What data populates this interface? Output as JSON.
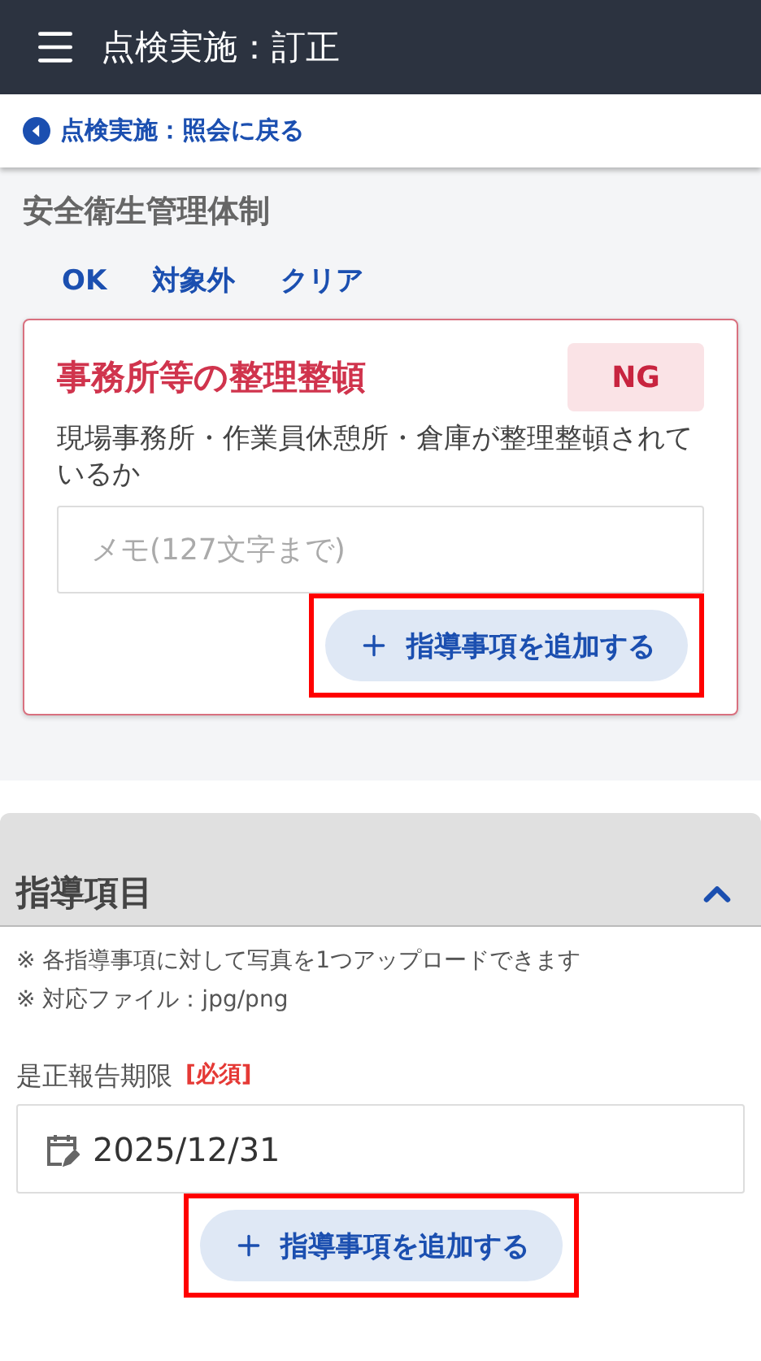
{
  "header": {
    "title": "点検実施：訂正"
  },
  "back_link": {
    "label": "点検実施：照会に戻る"
  },
  "section": {
    "title": "安全衛生管理体制",
    "choices": [
      {
        "label": "OK"
      },
      {
        "label": "対象外"
      },
      {
        "label": "クリア"
      }
    ],
    "item": {
      "title": "事務所等の整理整頓",
      "status": "NG",
      "description": "現場事務所・作業員休憩所・倉庫が整理整頓されているか",
      "memo": {
        "placeholder": "メモ(127文字まで)"
      },
      "add_button": {
        "label": "指導事項を追加する",
        "highlighted": true
      }
    }
  },
  "guidance_panel": {
    "title": "指導項目",
    "expanded": true,
    "notes": [
      "※ 各指導事項に対して写真を1つアップロードできます",
      "※ 対応ファイル：jpg/png"
    ],
    "deadline": {
      "label": "是正報告期限",
      "required": "[必須]",
      "value": "2025/12/31"
    },
    "add_button": {
      "label": "指導事項を追加する",
      "highlighted": true
    }
  }
}
